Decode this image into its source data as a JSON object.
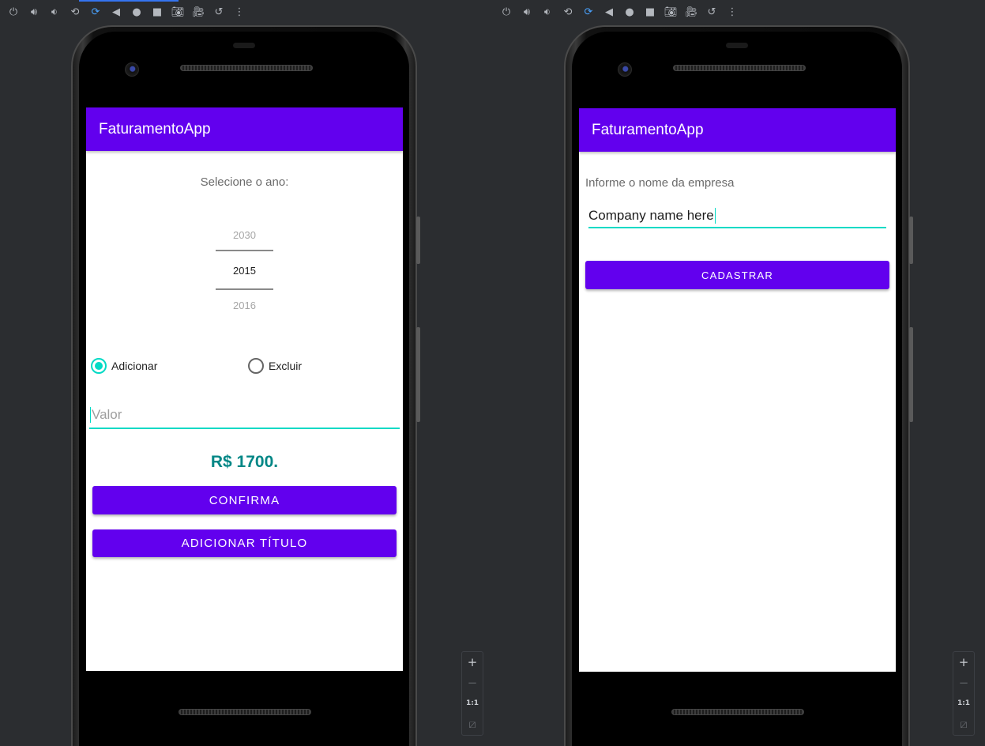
{
  "left": {
    "app_title": "FaturamentoApp",
    "year_label": "Selecione o ano:",
    "picker": {
      "prev": "2030",
      "selected": "2015",
      "next": "2016"
    },
    "radio_add": "Adicionar",
    "radio_remove": "Excluir",
    "selected_radio": "Adicionar",
    "value_placeholder": "Valor",
    "amount_text": "R$ 1700.",
    "confirm_label": "CONFIRMA",
    "add_title_label": "ADICIONAR TÍTULO"
  },
  "right": {
    "app_title": "FaturamentoApp",
    "company_label": "Informe o nome da empresa",
    "company_value": "Company name here",
    "register_label": "CADASTRAR"
  },
  "zoom": {
    "ratio": "1:1"
  },
  "colors": {
    "primary": "#6200ee",
    "accent": "#03dac5",
    "amount": "#018786",
    "ide_background": "#2b2d30"
  },
  "toolbar_icons": [
    "power-icon",
    "volume-up-icon",
    "volume-down-icon",
    "rotate-left-icon",
    "rotate-right-icon",
    "back-icon",
    "home-icon",
    "overview-icon",
    "camera-icon",
    "video-icon",
    "history-icon",
    "more-icon"
  ]
}
